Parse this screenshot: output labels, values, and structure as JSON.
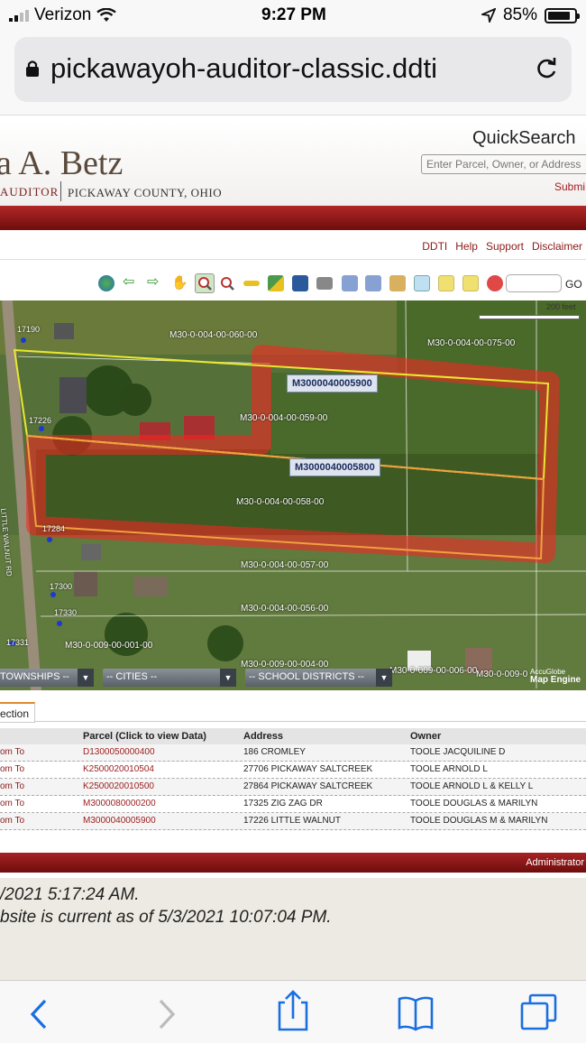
{
  "status_bar": {
    "carrier": "Verizon",
    "time": "9:27 PM",
    "battery": "85%"
  },
  "browser": {
    "url": "pickawayoh-auditor-classic.ddti"
  },
  "header": {
    "name": "a A. Betz",
    "auditor": "AUDITOR",
    "county": "PICKAWAY COUNTY, OHIO",
    "quicksearch_title": "QuickSearch",
    "quicksearch_placeholder": "Enter Parcel, Owner, or Address",
    "submit": "Submi"
  },
  "top_links": [
    "DDTI",
    "Help",
    "Support",
    "Disclaimer"
  ],
  "toolbar": {
    "go": "GO"
  },
  "map": {
    "scale": "200 feet",
    "parcel_labels": [
      "M30-0-004-00-060-00",
      "M30-0-004-00-075-00",
      "M30-0-004-00-059-00",
      "M30-0-004-00-058-00",
      "M30-0-004-00-057-00",
      "M30-0-004-00-056-00",
      "M30-0-009-00-001-00",
      "M30-0-009-00-004-00",
      "M30-0-009-00-006-00",
      "M30-0-009-0"
    ],
    "address_labels": [
      "17190",
      "17226",
      "17284",
      "17300",
      "17330",
      "17331"
    ],
    "road_label": "LITTLE WALNUT RD",
    "callouts": [
      "M3000040005900",
      "M3000040005800"
    ],
    "dropdowns": [
      "TOWNSHIPS --",
      "-- CITIES --",
      "-- SCHOOL DISTRICTS --"
    ],
    "attribution": {
      "line1": "AccuGlobe",
      "line2": "Map Engine"
    }
  },
  "results": {
    "tab": "ection",
    "headers": [
      "",
      "Parcel (Click to view Data)",
      "Address",
      "Owner"
    ],
    "rows": [
      {
        "action": "om To",
        "parcel": "D1300050000400",
        "address": "186 CROMLEY",
        "owner": "TOOLE JACQUILINE D"
      },
      {
        "action": "om To",
        "parcel": "K2500020010504",
        "address": "27706 PICKAWAY SALTCREEK",
        "owner": "TOOLE ARNOLD L"
      },
      {
        "action": "om To",
        "parcel": "K2500020010500",
        "address": "27864 PICKAWAY SALTCREEK",
        "owner": "TOOLE ARNOLD L & KELLY L"
      },
      {
        "action": "om To",
        "parcel": "M3000080000200",
        "address": "17325 ZIG ZAG DR",
        "owner": "TOOLE DOUGLAS & MARILYN"
      },
      {
        "action": "om To",
        "parcel": "M3000040005900",
        "address": "17226 LITTLE WALNUT",
        "owner": "TOOLE DOUGLAS M & MARILYN"
      }
    ]
  },
  "admin_bar": "Administrator",
  "footer": {
    "line1": "/2021 5:17:24 AM.",
    "line2": "bsite is current as of 5/3/2021 10:07:04 PM."
  }
}
